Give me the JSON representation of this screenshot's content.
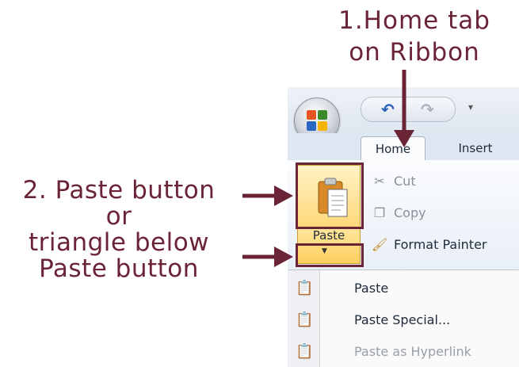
{
  "callouts": {
    "home_tab_line1": "1.Home tab",
    "home_tab_line2": "on Ribbon",
    "paste_line1": "2. Paste button",
    "paste_line2": "or",
    "paste_line3": "triangle below",
    "paste_line4": "Paste button",
    "accent_color": "#6b2336"
  },
  "ribbon": {
    "tabs": [
      {
        "label": "Home",
        "active": true
      },
      {
        "label": "Insert",
        "active": false
      }
    ],
    "clipboard": {
      "paste_label": "Paste",
      "cut_label": "Cut",
      "copy_label": "Copy",
      "format_painter_label": "Format Painter"
    }
  },
  "paste_menu": {
    "items": [
      {
        "label": "Paste",
        "icon": "clipboard-paste-icon",
        "enabled": true
      },
      {
        "label": "Paste Special...",
        "icon": "paste-special-icon",
        "enabled": true
      },
      {
        "label": "Paste as Hyperlink",
        "icon": "paste-hyperlink-icon",
        "enabled": false
      }
    ]
  }
}
